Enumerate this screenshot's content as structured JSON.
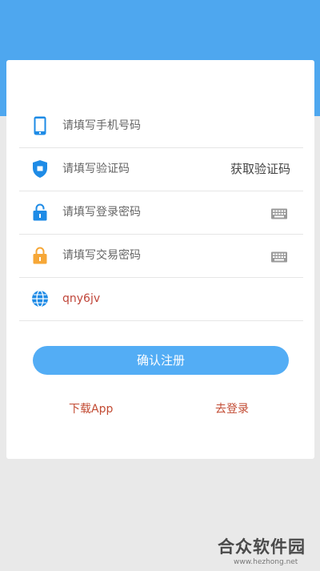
{
  "form": {
    "phone_placeholder": "请填写手机号码",
    "code_placeholder": "请填写验证码",
    "get_code_button": "获取验证码",
    "login_password_placeholder": "请填写登录密码",
    "trade_password_placeholder": "请填写交易密码",
    "captcha_value": "qny6jv",
    "submit_label": "确认注册",
    "download_link": "下载App",
    "login_link": "去登录"
  },
  "watermark": {
    "main": "合众软件园",
    "sub": "www.hezhong.net"
  },
  "colors": {
    "brand_blue": "#4ea7ef",
    "button_blue": "#53adf5",
    "link_red": "#c24b33",
    "icon_blue": "#1e8be6",
    "icon_orange": "#f6a737"
  },
  "icons": {
    "phone": "phone-icon",
    "shield": "shield-icon",
    "lock_blue": "lock-icon",
    "lock_orange": "lock-icon",
    "globe": "globe-icon",
    "keyboard": "keyboard-icon"
  }
}
